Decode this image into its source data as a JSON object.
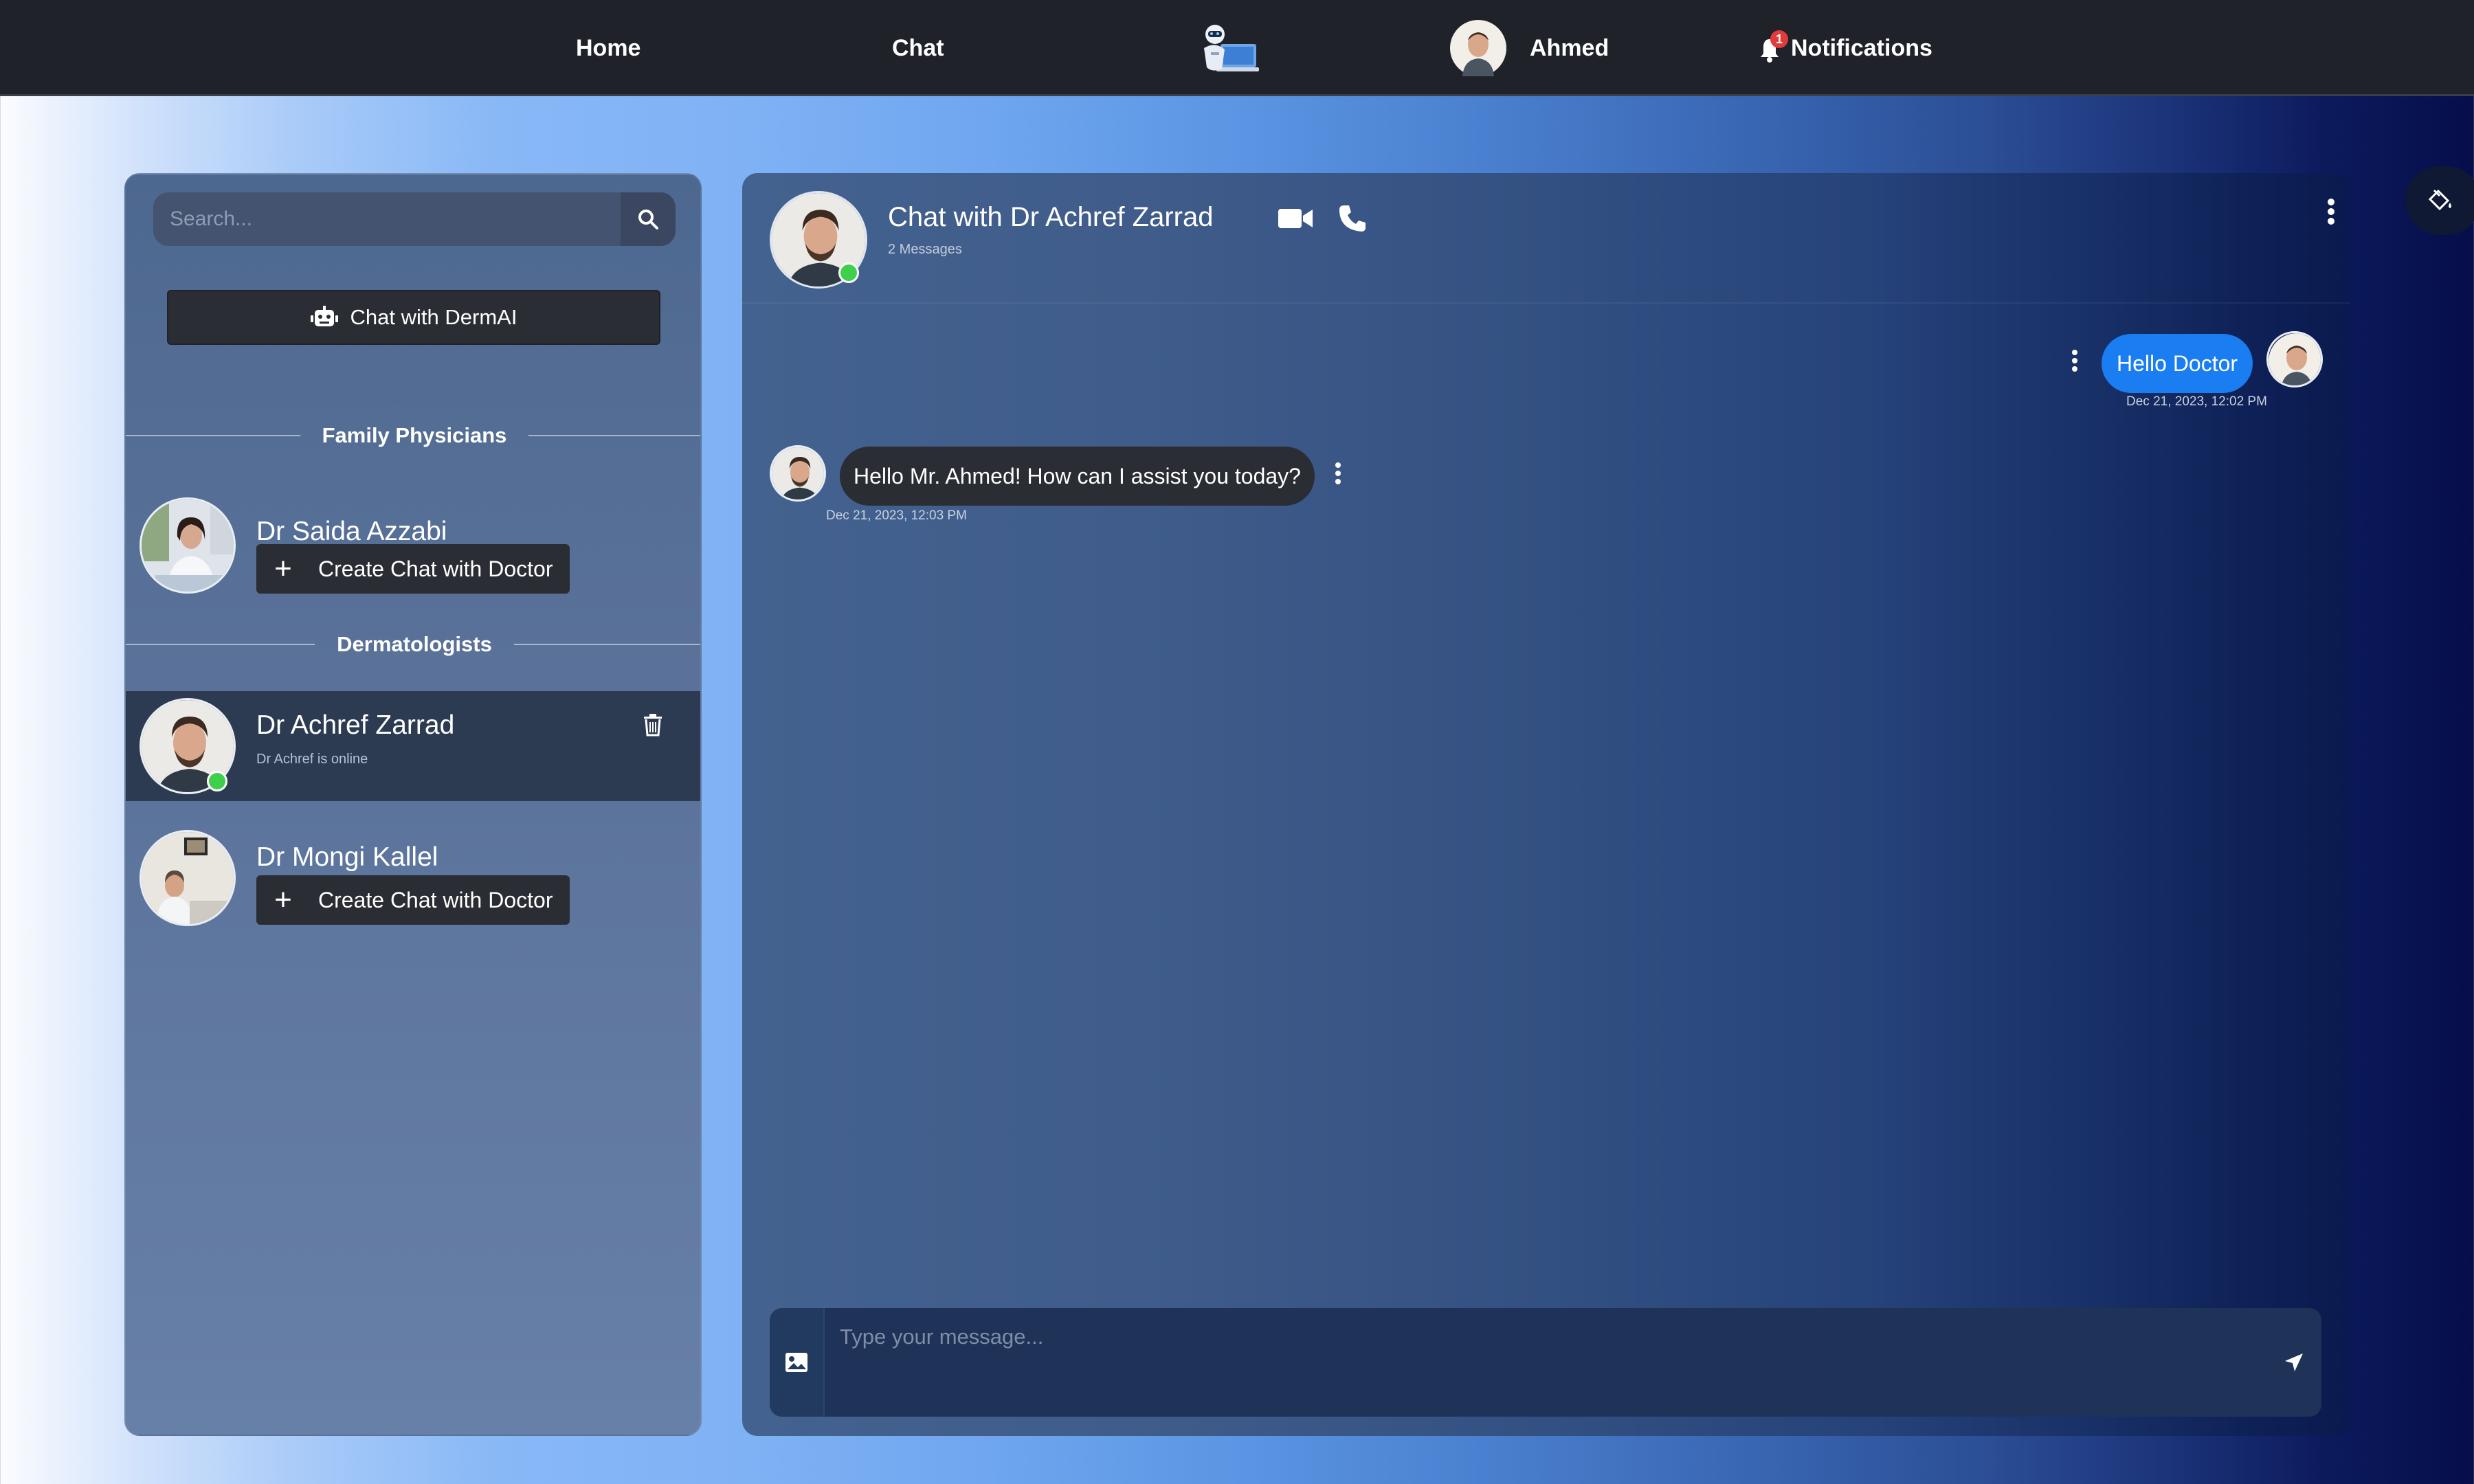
{
  "nav": {
    "home_label": "Home",
    "chat_label": "Chat",
    "logo_icon": "robot-laptop-logo-icon",
    "user_name": "Ahmed",
    "notifications_label": "Notifications",
    "notification_count": "1"
  },
  "sidebar": {
    "search_placeholder": "Search...",
    "dermai_label": "Chat with DermAI",
    "sections": [
      {
        "title": "Family Physicians",
        "doctors": [
          {
            "name": "Dr Saida Azzabi",
            "action": "Create Chat with Doctor"
          }
        ]
      },
      {
        "title": "Dermatologists",
        "doctors": [
          {
            "name": "Dr Achref Zarrad",
            "status": "Dr Achref is online",
            "active": true
          },
          {
            "name": "Dr Mongi Kallel",
            "action": "Create Chat with Doctor"
          }
        ]
      }
    ]
  },
  "chat": {
    "title": "Chat with Dr Achref Zarrad",
    "message_count": "2 Messages",
    "messages": [
      {
        "direction": "outgoing",
        "text": "Hello Doctor",
        "time": "Dec 21, 2023, 12:02 PM"
      },
      {
        "direction": "incoming",
        "text": "Hello Mr. Ahmed! How can I assist you today?",
        "time": "Dec 21, 2023, 12:03 PM"
      }
    ],
    "composer_placeholder": "Type your message..."
  },
  "colors": {
    "topnav_bg": "#1f2329",
    "outgoing_bubble": "#1a7df1",
    "incoming_bubble": "#2a2d33",
    "online": "#3ed04a",
    "badge": "#e23b3b"
  }
}
